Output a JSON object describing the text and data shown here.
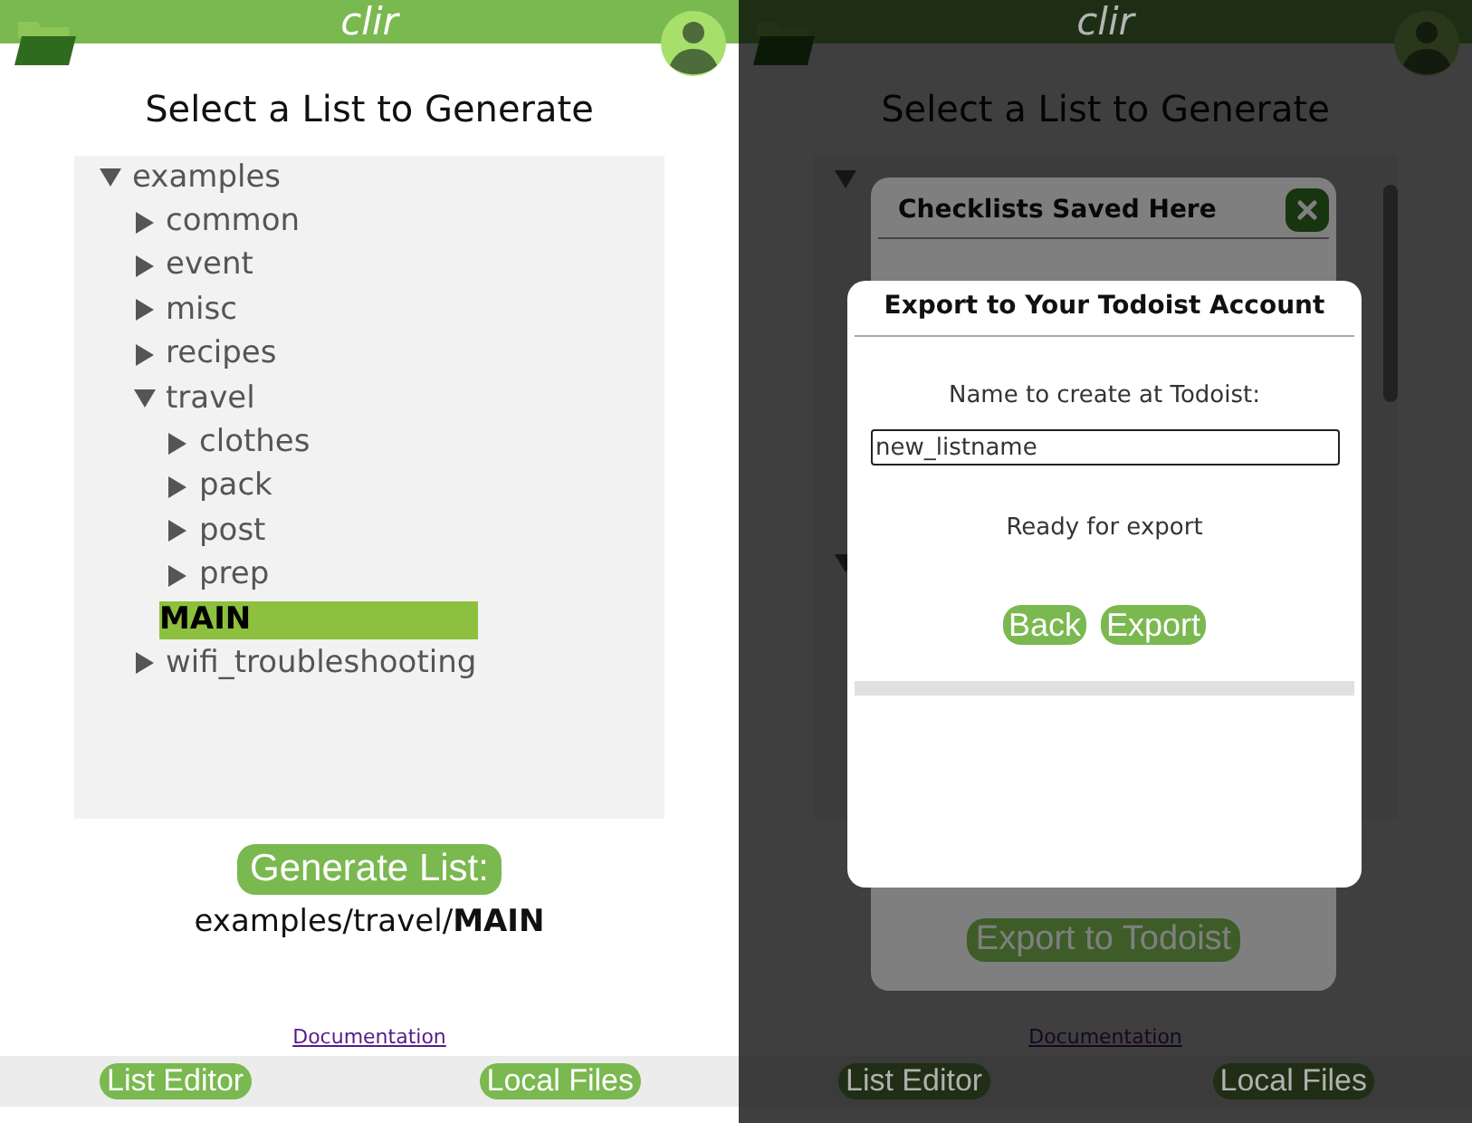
{
  "app": {
    "header_title": "clir",
    "heading": "Select a List to Generate",
    "tree": [
      {
        "label": "examples",
        "expanded": true,
        "selected": false,
        "children": [
          {
            "label": "common",
            "expanded": false,
            "selected": false
          },
          {
            "label": "event",
            "expanded": false,
            "selected": false
          },
          {
            "label": "misc",
            "expanded": false,
            "selected": false
          },
          {
            "label": "recipes",
            "expanded": false,
            "selected": false
          },
          {
            "label": "travel",
            "expanded": true,
            "selected": false,
            "children": [
              {
                "label": "clothes",
                "expanded": false,
                "selected": false
              },
              {
                "label": "pack",
                "expanded": false,
                "selected": false
              },
              {
                "label": "post",
                "expanded": false,
                "selected": false
              },
              {
                "label": "prep",
                "expanded": false,
                "selected": false
              },
              {
                "label": "MAIN",
                "selected": true
              }
            ]
          },
          {
            "label": "wifi_troubleshooting",
            "expanded": false,
            "selected": false
          }
        ]
      }
    ],
    "generate_button": "Generate List:",
    "selected_path": "examples/travel/**MAIN**",
    "documentation_link": "Documentation",
    "footer_buttons": [
      "List Editor",
      "Local Files"
    ]
  },
  "dimmed_app": {
    "header_title": "clir",
    "heading": "Select a List to Generate",
    "documentation_link": "Documentation",
    "footer_buttons": [
      "List Editor",
      "Local Files"
    ],
    "checklists_dialog": {
      "title": "Checklists Saved Here",
      "export_button": "Export to Todoist"
    },
    "export_dialog": {
      "title": "Export to Your Todoist Account",
      "field_label": "Name to create at Todoist:",
      "field_value": "new_listname",
      "status": "Ready for export",
      "buttons": [
        "Back",
        "Export"
      ]
    }
  }
}
